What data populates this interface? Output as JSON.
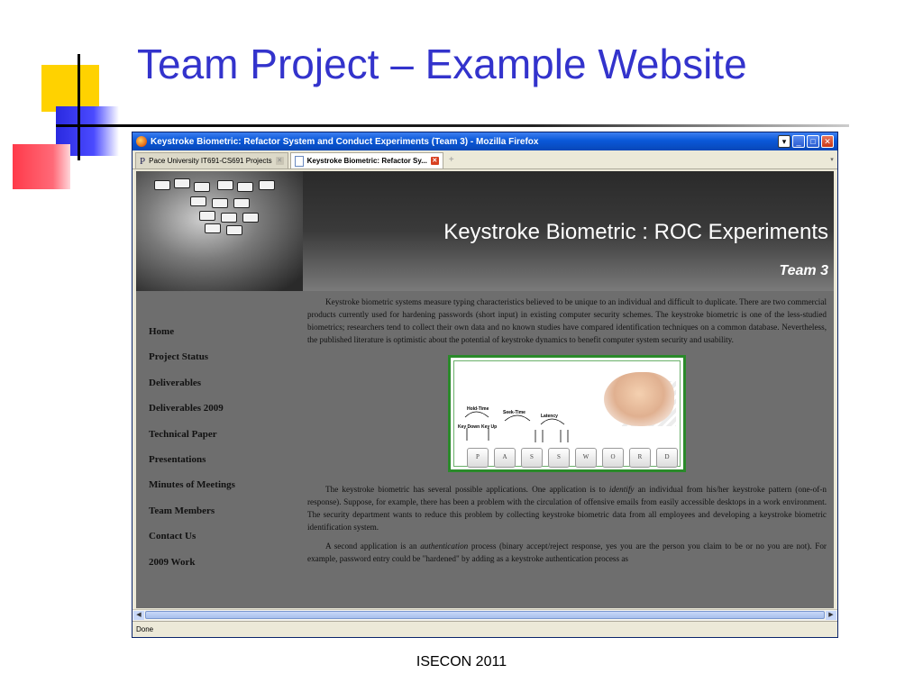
{
  "slide": {
    "title": "Team Project – Example Website",
    "footer": "ISECON 2011"
  },
  "browser": {
    "window_title": "Keystroke Biometric: Refactor System and Conduct Experiments (Team 3) - Mozilla Firefox",
    "tabs": [
      {
        "label": "Pace University IT691-CS691 Projects",
        "active": false
      },
      {
        "label": "Keystroke Biometric: Refactor Sy...",
        "active": true
      }
    ],
    "status": "Done"
  },
  "site": {
    "banner_title": "Keystroke Biometric : ROC Experiments",
    "banner_team": "Team 3",
    "nav": [
      "Home",
      "Project Status",
      "Deliverables",
      "Deliverables 2009",
      "Technical Paper",
      "Presentations",
      "Minutes of Meetings",
      "Team Members",
      "Contact Us",
      "2009 Work"
    ],
    "para1": "Keystroke biometric systems measure typing characteristics believed to be unique to an individual and difficult to duplicate. There are two commercial products currently used for hardening passwords (short input) in existing computer security schemes. The keystroke biometric is one of the less-studied biometrics; researchers tend to collect their own data and no known studies have compared identification techniques on a common database. Nevertheless, the published literature is optimistic about the potential of keystroke dynamics to benefit computer system security and usability.",
    "para2_a": "The keystroke biometric has several possible applications. One application is to ",
    "para2_em": "identify",
    "para2_b": " an individual from his/her keystroke pattern (one-of-n response). Suppose, for example, there has been a problem with the circulation of offensive emails from easily accessible desktops in a work environment. The security department wants to reduce this problem by collecting keystroke biometric data from all employees and developing a keystroke biometric identification system.",
    "para3_a": "A second application is an ",
    "para3_em": "authentication",
    "para3_b": " process (binary accept/reject response, yes you are the person you claim to be or no you are not). For example, password entry could be \"hardened\" by adding as a keystroke authentication process as",
    "figure": {
      "labels": [
        "Hold-Time",
        "Seek-Time",
        "Latency",
        "Key Down",
        "Key Up"
      ],
      "keys": [
        "P",
        "A",
        "S",
        "S",
        "W",
        "O",
        "R",
        "D"
      ]
    }
  }
}
